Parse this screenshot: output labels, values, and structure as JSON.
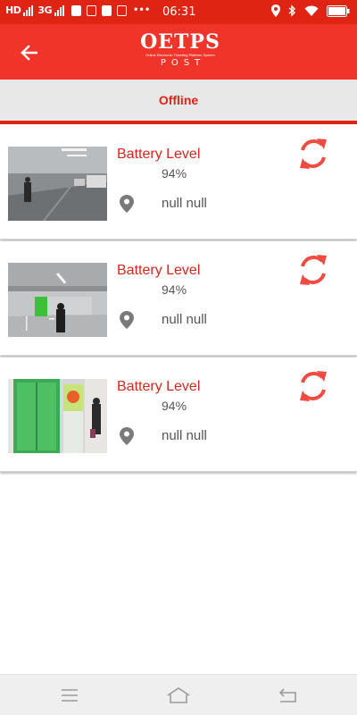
{
  "status_bar": {
    "signal_1_label": "HD",
    "signal_2_label": "3G",
    "time": "06:31"
  },
  "app_bar": {
    "logo_text": "OETPS",
    "logo_tagline": "Online Electronic Ticketing Platform System",
    "logo_subtext": "POST"
  },
  "tab": {
    "label": "Offline"
  },
  "devices": [
    {
      "battery_label": "Battery Level",
      "battery_value": "94%",
      "location": "null null",
      "thumbnail": "parking-garage-scene"
    },
    {
      "battery_label": "Battery Level",
      "battery_value": "94%",
      "location": "null null",
      "thumbnail": "parking-entrance-scene"
    },
    {
      "battery_label": "Battery Level",
      "battery_value": "94%",
      "location": "null null",
      "thumbnail": "green-elevator-door-scene"
    }
  ],
  "colors": {
    "status_bar": "#e02414",
    "app_bar": "#f0342a",
    "accent": "#e02414",
    "refresh_icon": "#ef4b40",
    "tab_background": "#e8e8e8"
  },
  "icons": {
    "back": "arrow-left-icon",
    "location": "map-pin-icon",
    "refresh": "sync-icon",
    "nav_menu": "menu-icon",
    "nav_home": "home-icon",
    "nav_back": "return-icon"
  }
}
